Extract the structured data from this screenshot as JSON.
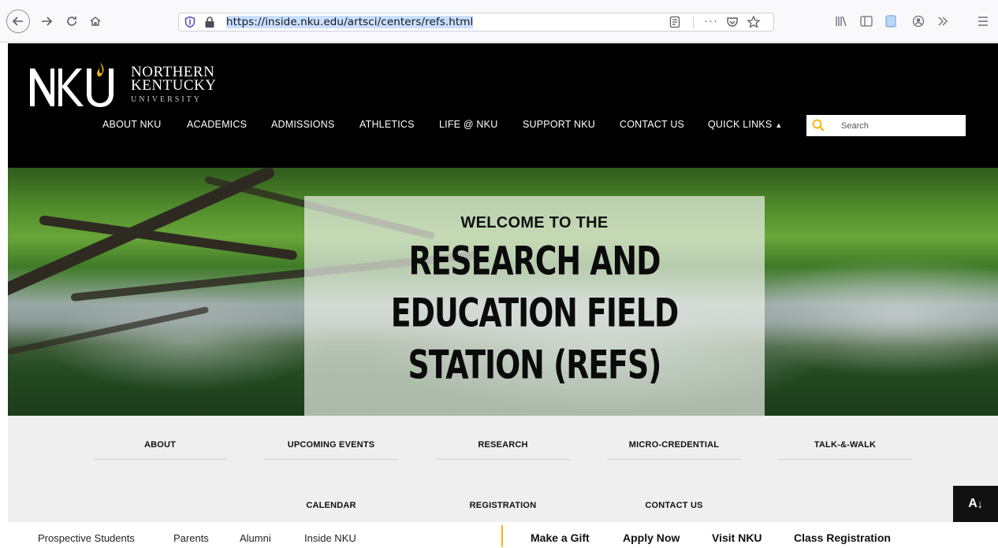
{
  "browser": {
    "url": "https://inside.nku.edu/artsci/centers/refs.html",
    "more_label": "···",
    "icons": [
      "back-icon",
      "forward-icon",
      "reload-icon",
      "home-icon",
      "shield-icon",
      "lock-icon",
      "reader-view-icon",
      "more-icon",
      "pocket-icon",
      "bookmark-star-icon",
      "library-icon",
      "sidebar-icon",
      "screenshot-icon",
      "account-icon",
      "overflow-icon",
      "menu-icon"
    ]
  },
  "header": {
    "logo_alt": "NKU",
    "logo_lines": [
      "NORTHERN",
      "KENTUCKY",
      "UNIVERSITY"
    ],
    "nav": [
      {
        "label": "ABOUT NKU"
      },
      {
        "label": "ACADEMICS"
      },
      {
        "label": "ADMISSIONS"
      },
      {
        "label": "ATHLETICS"
      },
      {
        "label": "LIFE @ NKU"
      },
      {
        "label": "SUPPORT NKU"
      },
      {
        "label": "CONTACT US"
      },
      {
        "label": "QUICK LINKS"
      }
    ],
    "search_placeholder": "Search",
    "accent_color": "#f5b80b"
  },
  "hero": {
    "welcome": "WELCOME TO THE",
    "title_lines": [
      "RESEARCH AND",
      "EDUCATION FIELD",
      "STATION (REFS)"
    ]
  },
  "subnav": {
    "row1": [
      "ABOUT",
      "UPCOMING EVENTS",
      "RESEARCH",
      "MICRO-CREDENTIAL",
      "TALK-&-WALK"
    ],
    "row2": [
      "CALENDAR",
      "REGISTRATION",
      "CONTACT US"
    ]
  },
  "accessibility": {
    "label": "A"
  },
  "footer": {
    "links": [
      "Prospective Students",
      "Parents",
      "Alumni",
      "Inside NKU"
    ],
    "ctas": [
      "Make a Gift",
      "Apply Now",
      "Visit NKU",
      "Class Registration"
    ]
  }
}
